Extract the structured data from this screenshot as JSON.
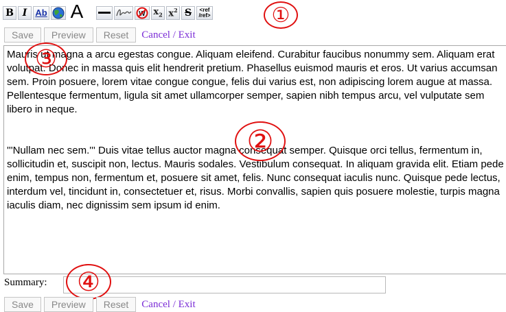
{
  "toolbar": {
    "bold_label": "B",
    "italic_label": "I",
    "link_label": "Ab",
    "headline_label": "A",
    "subscript_label": "x",
    "subscript_num": "2",
    "superscript_label": "x",
    "superscript_num": "2",
    "strike_label": "S",
    "ref_line1": "<ref",
    "ref_line2": "/ref>",
    "icons": [
      "bold-icon",
      "italic-icon",
      "internal-link-icon",
      "external-link-globe-icon",
      "headline-icon",
      "horizontal-rule-icon",
      "signature-icon",
      "nowiki-icon",
      "subscript-icon",
      "superscript-icon",
      "strikethrough-icon",
      "reference-icon"
    ]
  },
  "callouts": [
    "①",
    "②",
    "③",
    "④"
  ],
  "top_buttons": {
    "save": "Save",
    "preview": "Preview",
    "reset": "Reset",
    "cancel": "Cancel / Exit"
  },
  "editor": {
    "paragraph1": "Mauris ut magna a arcu egestas congue. Aliquam eleifend. Curabitur faucibus nonummy sem. Aliquam erat volutpat. Donec in massa quis elit hendrerit pretium. Phasellus euismod mauris et eros. Ut varius accumsan sem. Proin posuere, lorem vitae congue congue, felis dui varius est, non adipiscing lorem augue at massa. Pellentesque fermentum, ligula sit amet ullamcorper semper, sapien nibh tempus arcu, vel vulputate sem libero in neque.",
    "paragraph2": "'''Nullam nec sem.''' Duis vitae tellus auctor magna consequat semper. Quisque orci tellus, fermentum in, sollicitudin et, suscipit non, lectus. Mauris sodales. Vestibulum consequat. In aliquam gravida elit. Etiam pede enim, tempus non, fermentum et, posuere sit amet, felis. Nunc consequat iaculis nunc. Quisque pede lectus, interdum vel, tincidunt in, consectetuer et, risus. Morbi convallis, sapien quis posuere molestie, turpis magna iaculis diam, nec dignissim sem ipsum id enim."
  },
  "summary": {
    "label": "Summary:",
    "value": ""
  },
  "bottom_buttons": {
    "save": "Save",
    "preview": "Preview",
    "reset": "Reset",
    "cancel": "Cancel / Exit"
  },
  "colors": {
    "callout": "#e01010",
    "link": "#7a2bd6",
    "button_text": "#888888"
  }
}
